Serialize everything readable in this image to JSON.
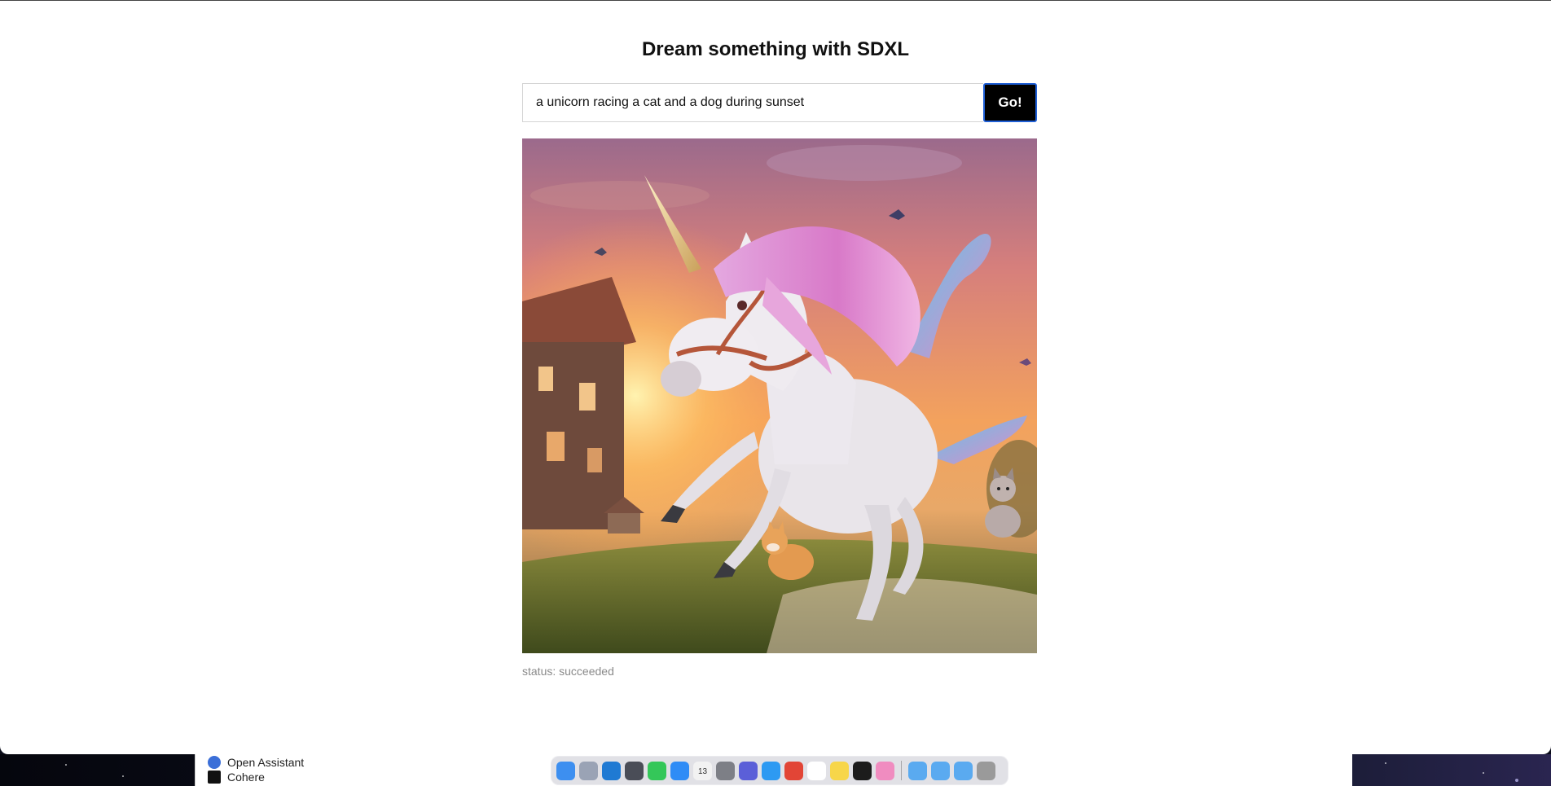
{
  "app": {
    "title": "Dream something with SDXL",
    "prompt": {
      "value": "a unicorn racing a cat and a dog during sunset",
      "placeholder": ""
    },
    "submit_label": "Go!",
    "status_label": "status:",
    "status_value": "succeeded"
  },
  "background_window": {
    "items": [
      {
        "label": "Open Assistant",
        "icon": "open-assistant-icon",
        "color": "#3b6fd8"
      },
      {
        "label": "Cohere",
        "icon": "cohere-icon",
        "color": "#111111"
      }
    ]
  },
  "dock": {
    "apps": [
      {
        "name": "finder-icon",
        "color": "#3d8ff0"
      },
      {
        "name": "launchpad-icon",
        "color": "#9aa3b5"
      },
      {
        "name": "vscode-icon",
        "color": "#1f7ad3"
      },
      {
        "name": "chatgpt-icon",
        "color": "#4a4d57"
      },
      {
        "name": "messages-icon",
        "color": "#34c759"
      },
      {
        "name": "mail-icon",
        "color": "#2f8cf6"
      },
      {
        "name": "calendar-icon",
        "color": "#f2f2f2"
      },
      {
        "name": "system-settings-icon",
        "color": "#7d7f86"
      },
      {
        "name": "linear-icon",
        "color": "#5b5fd8"
      },
      {
        "name": "safari-icon",
        "color": "#2d9af2"
      },
      {
        "name": "chrome-icon",
        "color": "#e24536"
      },
      {
        "name": "notion-icon",
        "color": "#ffffff"
      },
      {
        "name": "notes-icon",
        "color": "#f7d64a"
      },
      {
        "name": "terminal-icon",
        "color": "#1c1c1c"
      },
      {
        "name": "pink-app-icon",
        "color": "#f08cc0"
      }
    ],
    "folders": [
      {
        "name": "app-folder-icon",
        "color": "#5aaaf0"
      },
      {
        "name": "documents-folder-icon",
        "color": "#5aaaf0"
      },
      {
        "name": "downloads-folder-icon",
        "color": "#5aaaf0"
      },
      {
        "name": "trash-icon",
        "color": "#9a9a9a"
      }
    ],
    "calendar_day": "13"
  },
  "colors": {
    "button_bg": "#000000",
    "button_border": "#1f5fd6",
    "status_text": "#8a8a8a"
  }
}
